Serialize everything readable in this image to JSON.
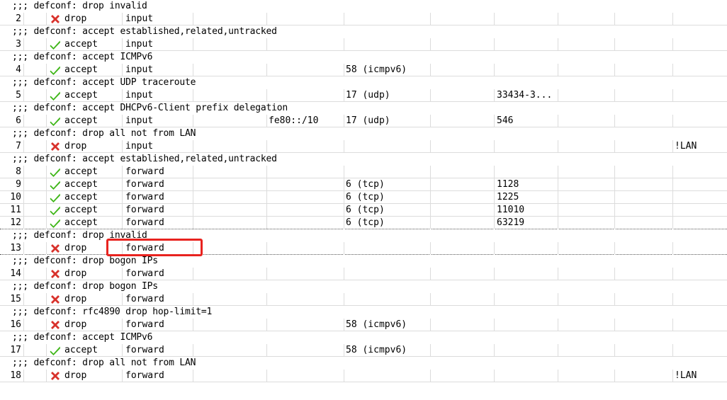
{
  "colors": {
    "accept_icon": "#3fb618",
    "drop_icon": "#d8312b",
    "highlight": "#e8231f"
  },
  "rows": [
    {
      "kind": "comment",
      "text": ";;; defconf: drop invalid"
    },
    {
      "kind": "rule",
      "num": "2",
      "icon": "red-x-icon",
      "action": "drop",
      "chain": "input",
      "src": "",
      "proto": "",
      "dport": "",
      "in": ""
    },
    {
      "kind": "comment",
      "text": ";;; defconf: accept established,related,untracked"
    },
    {
      "kind": "rule",
      "num": "3",
      "icon": "green-check-icon",
      "action": "accept",
      "chain": "input",
      "src": "",
      "proto": "",
      "dport": "",
      "in": ""
    },
    {
      "kind": "comment",
      "text": ";;; defconf: accept ICMPv6"
    },
    {
      "kind": "rule",
      "num": "4",
      "icon": "green-check-icon",
      "action": "accept",
      "chain": "input",
      "src": "",
      "proto": "58 (icmpv6)",
      "dport": "",
      "in": ""
    },
    {
      "kind": "comment",
      "text": ";;; defconf: accept UDP traceroute"
    },
    {
      "kind": "rule",
      "num": "5",
      "icon": "green-check-icon",
      "action": "accept",
      "chain": "input",
      "src": "",
      "proto": "17 (udp)",
      "dport": "33434-3...",
      "in": ""
    },
    {
      "kind": "comment",
      "text": ";;; defconf: accept DHCPv6-Client prefix delegation"
    },
    {
      "kind": "rule",
      "num": "6",
      "icon": "green-check-icon",
      "action": "accept",
      "chain": "input",
      "src": "fe80::/10",
      "proto": "17 (udp)",
      "dport": "546",
      "in": ""
    },
    {
      "kind": "comment",
      "text": ";;; defconf: drop all not from LAN"
    },
    {
      "kind": "rule",
      "num": "7",
      "icon": "red-x-icon",
      "action": "drop",
      "chain": "input",
      "src": "",
      "proto": "",
      "dport": "",
      "in": "!LAN"
    },
    {
      "kind": "comment",
      "text": ";;; defconf: accept established,related,untracked"
    },
    {
      "kind": "rule",
      "num": "8",
      "icon": "green-check-icon",
      "action": "accept",
      "chain": "forward",
      "src": "",
      "proto": "",
      "dport": "",
      "in": ""
    },
    {
      "kind": "rule",
      "num": "9",
      "icon": "green-check-icon",
      "action": "accept",
      "chain": "forward",
      "src": "",
      "proto": "6 (tcp)",
      "dport": "1128",
      "in": ""
    },
    {
      "kind": "rule",
      "num": "10",
      "icon": "green-check-icon",
      "action": "accept",
      "chain": "forward",
      "src": "",
      "proto": "6 (tcp)",
      "dport": "1225",
      "in": ""
    },
    {
      "kind": "rule",
      "num": "11",
      "icon": "green-check-icon",
      "action": "accept",
      "chain": "forward",
      "src": "",
      "proto": "6 (tcp)",
      "dport": "11010",
      "in": ""
    },
    {
      "kind": "rule",
      "num": "12",
      "icon": "green-check-icon",
      "action": "accept",
      "chain": "forward",
      "src": "",
      "proto": "6 (tcp)",
      "dport": "63219",
      "in": "",
      "dotted": true
    },
    {
      "kind": "comment",
      "text": ";;; defconf: drop invalid"
    },
    {
      "kind": "rule",
      "num": "13",
      "icon": "red-x-icon",
      "action": "drop",
      "chain": "forward",
      "src": "",
      "proto": "",
      "dport": "",
      "in": "",
      "dotted": true
    },
    {
      "kind": "comment",
      "text": ";;; defconf: drop bogon IPs"
    },
    {
      "kind": "rule",
      "num": "14",
      "icon": "red-x-icon",
      "action": "drop",
      "chain": "forward",
      "src": "",
      "proto": "",
      "dport": "",
      "in": ""
    },
    {
      "kind": "comment",
      "text": ";;; defconf: drop bogon IPs"
    },
    {
      "kind": "rule",
      "num": "15",
      "icon": "red-x-icon",
      "action": "drop",
      "chain": "forward",
      "src": "",
      "proto": "",
      "dport": "",
      "in": ""
    },
    {
      "kind": "comment",
      "text": ";;; defconf: rfc4890 drop hop-limit=1"
    },
    {
      "kind": "rule",
      "num": "16",
      "icon": "red-x-icon",
      "action": "drop",
      "chain": "forward",
      "src": "",
      "proto": "58 (icmpv6)",
      "dport": "",
      "in": ""
    },
    {
      "kind": "comment",
      "text": ";;; defconf: accept ICMPv6"
    },
    {
      "kind": "rule",
      "num": "17",
      "icon": "green-check-icon",
      "action": "accept",
      "chain": "forward",
      "src": "",
      "proto": "58 (icmpv6)",
      "dport": "",
      "in": ""
    },
    {
      "kind": "comment",
      "text": ";;; defconf: drop all not from LAN"
    },
    {
      "kind": "rule",
      "num": "18",
      "icon": "red-x-icon",
      "action": "drop",
      "chain": "forward",
      "src": "",
      "proto": "",
      "dport": "",
      "in": "!LAN"
    }
  ]
}
